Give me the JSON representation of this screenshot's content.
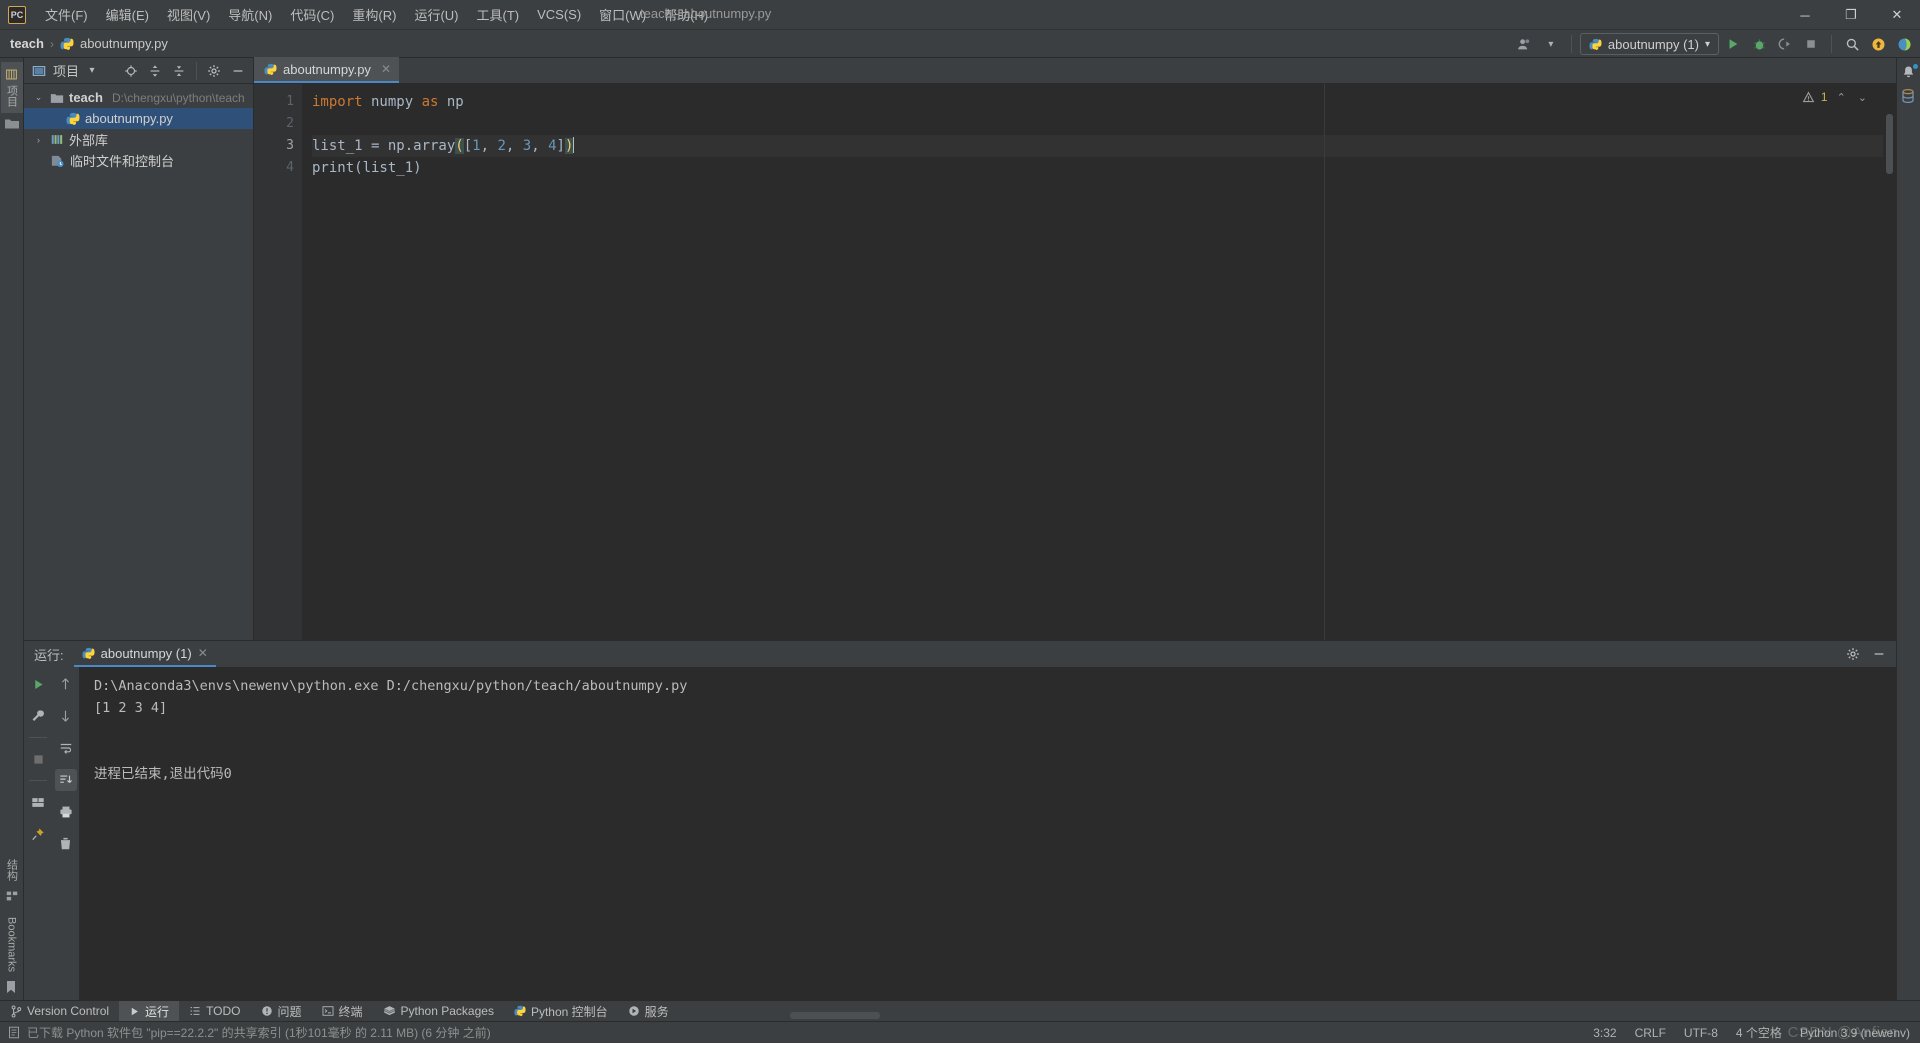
{
  "window": {
    "title": "teach - aboutnumpy.py",
    "app_badge": "PC",
    "minimize": "─",
    "maximize": "❐",
    "close": "✕"
  },
  "menu": [
    {
      "label": "文件(F)",
      "name": "menu-file"
    },
    {
      "label": "编辑(E)",
      "name": "menu-edit"
    },
    {
      "label": "视图(V)",
      "name": "menu-view"
    },
    {
      "label": "导航(N)",
      "name": "menu-navigate"
    },
    {
      "label": "代码(C)",
      "name": "menu-code"
    },
    {
      "label": "重构(R)",
      "name": "menu-refactor"
    },
    {
      "label": "运行(U)",
      "name": "menu-run"
    },
    {
      "label": "工具(T)",
      "name": "menu-tools"
    },
    {
      "label": "VCS(S)",
      "name": "menu-vcs"
    },
    {
      "label": "窗口(W)",
      "name": "menu-window"
    },
    {
      "label": "帮助(H)",
      "name": "menu-help"
    }
  ],
  "breadcrumb": {
    "root": "teach",
    "separator": "›",
    "file": "aboutnumpy.py"
  },
  "toolbar": {
    "run_config": "aboutnumpy (1)",
    "dropdown_arrow": "▾"
  },
  "project_panel": {
    "title": "项目",
    "dropdown": "▾",
    "tree": [
      {
        "label": "teach",
        "path": "D:\\chengxu\\python\\teach",
        "twisty": "⌄",
        "selected": false,
        "name": "tree-node-teach"
      },
      {
        "label": "aboutnumpy.py",
        "path": "",
        "twisty": "",
        "selected": true,
        "name": "tree-node-aboutnumpy"
      },
      {
        "label": "外部库",
        "path": "",
        "twisty": "›",
        "selected": false,
        "name": "tree-node-external-libraries"
      },
      {
        "label": "临时文件和控制台",
        "path": "",
        "twisty": "",
        "selected": false,
        "name": "tree-node-scratches"
      }
    ]
  },
  "left_stripe": {
    "project_tab": "项目",
    "structure_tab": "结构",
    "bookmarks_tab": "Bookmarks"
  },
  "editor": {
    "tab_label": "aboutnumpy.py",
    "tab_close": "✕",
    "warning_count": "1",
    "chevron_up": "⌃",
    "chevron_down": "⌄",
    "gutter": [
      "1",
      "2",
      "3",
      "4"
    ],
    "code": {
      "l1_kw": "import",
      "l1_rest": " numpy ",
      "l1_kw2": "as",
      "l1_rest2": " np",
      "l3_a": "list_1 = np.array",
      "l3_paren_open": "(",
      "l3_bracket_open": "[",
      "l3_n1": "1",
      "l3_c1": ", ",
      "l3_n2": "2",
      "l3_c2": ", ",
      "l3_n3": "3",
      "l3_c3": ", ",
      "l3_n4": "4",
      "l3_bracket_close": "]",
      "l3_paren_close": ")",
      "l4": "print(list_1)"
    }
  },
  "run_window": {
    "label": "运行:",
    "tab": "aboutnumpy (1)",
    "tab_close": "✕",
    "console": [
      "D:\\Anaconda3\\envs\\newenv\\python.exe D:/chengxu/python/teach/aboutnumpy.py",
      "[1 2 3 4]",
      "",
      "进程已结束,退出代码0"
    ]
  },
  "toolwindow_bar": [
    {
      "label": "Version Control",
      "icon": "branch-icon",
      "active": false,
      "name": "toolwindow-version-control"
    },
    {
      "label": "运行",
      "icon": "run-icon",
      "active": true,
      "name": "toolwindow-run"
    },
    {
      "label": "TODO",
      "icon": "list-icon",
      "active": false,
      "name": "toolwindow-todo"
    },
    {
      "label": "问题",
      "icon": "problems-icon",
      "active": false,
      "name": "toolwindow-problems"
    },
    {
      "label": "终端",
      "icon": "terminal-icon",
      "active": false,
      "name": "toolwindow-terminal"
    },
    {
      "label": "Python Packages",
      "icon": "packages-icon",
      "active": false,
      "name": "toolwindow-python-packages"
    },
    {
      "label": "Python 控制台",
      "icon": "python-icon",
      "active": false,
      "name": "toolwindow-python-console"
    },
    {
      "label": "服务",
      "icon": "services-icon",
      "active": false,
      "name": "toolwindow-services"
    }
  ],
  "status_bar": {
    "message": "已下载 Python 软件包 \"pip==22.2.2\" 的共享索引 (1秒101毫秒 的 2.11 MB) (6 分钟 之前)",
    "caret_position": "3:32",
    "line_separator": "CRLF",
    "encoding": "UTF-8",
    "indent": "4 个空格",
    "interpreter": "Python 3.9 (newenv)",
    "watermark": "CSDN @Anfien"
  }
}
